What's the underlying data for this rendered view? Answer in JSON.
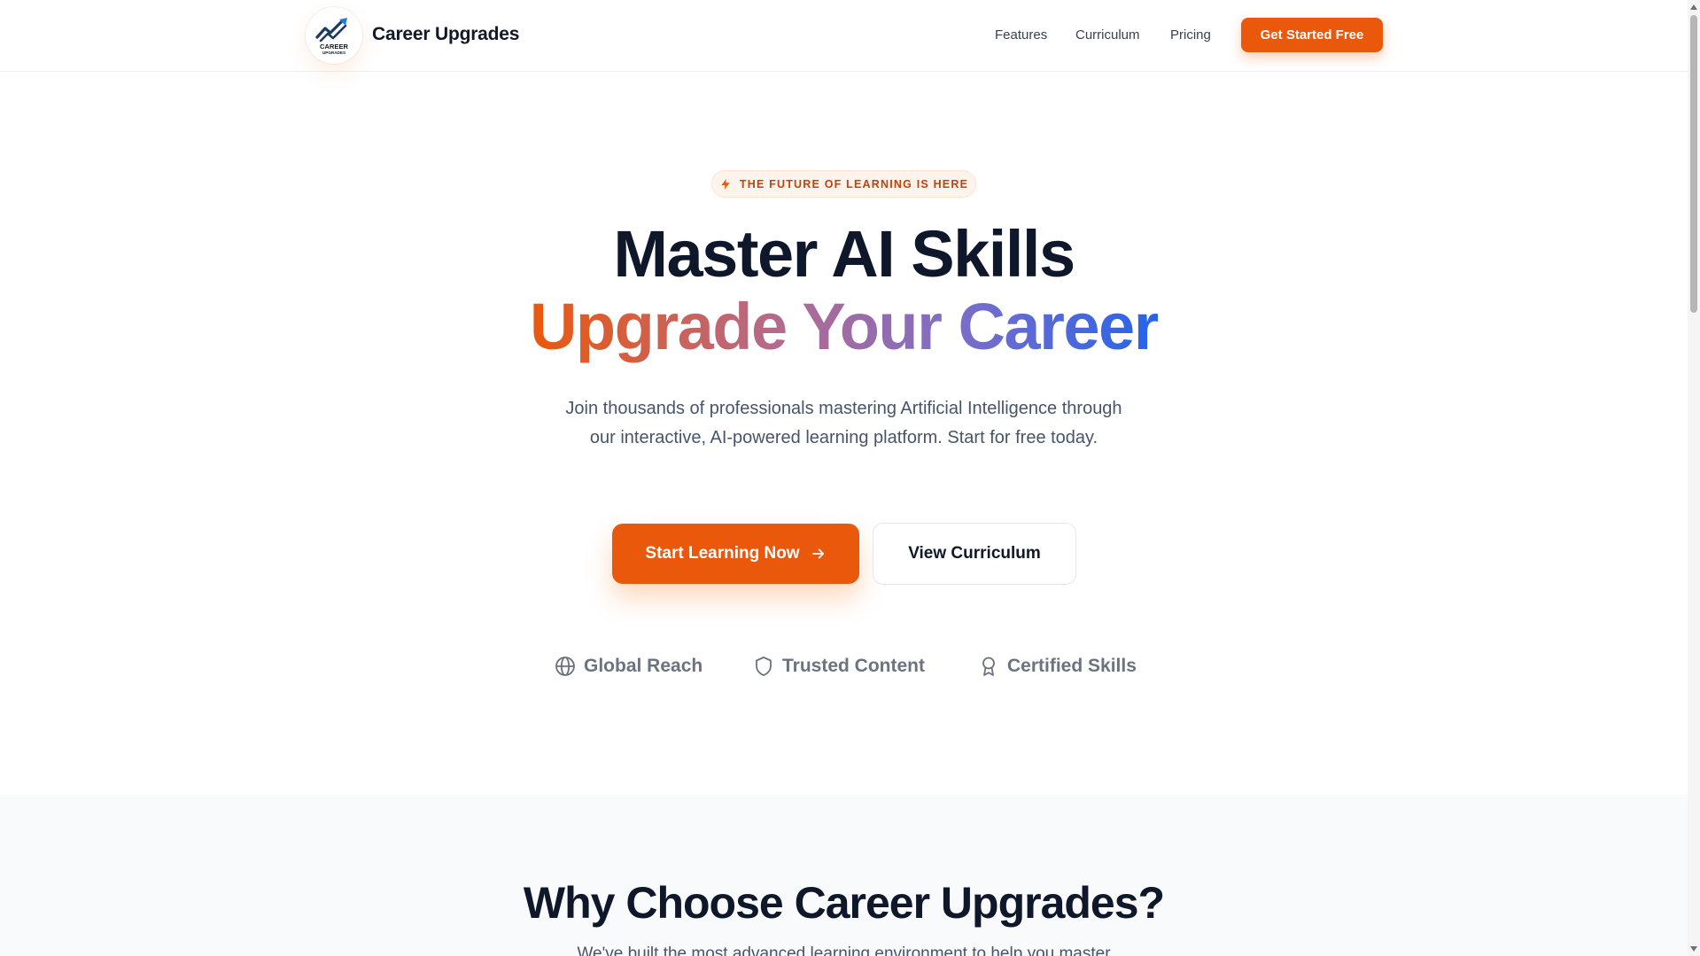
{
  "header": {
    "logo_icon": "career-upgrades-logo",
    "logo_text_top": "CAREER",
    "logo_text_bottom": "UPGRADES",
    "brand": "Career Upgrades",
    "nav": [
      "Features",
      "Curriculum",
      "Pricing"
    ],
    "cta": "Get Started Free"
  },
  "hero": {
    "badge_icon": "lightning-icon",
    "badge": "THE FUTURE OF LEARNING IS HERE",
    "title": "Master AI Skills",
    "subtitle": "Upgrade Your Career",
    "description": "Join thousands of professionals mastering Artificial Intelligence through our interactive, AI-powered learning platform. Start for free today.",
    "primary_button": "Start Learning Now",
    "primary_button_icon": "arrow-right-icon",
    "secondary_button": "View Curriculum"
  },
  "trust": [
    {
      "icon": "globe-icon",
      "label": "Global Reach"
    },
    {
      "icon": "shield-icon",
      "label": "Trusted Content"
    },
    {
      "icon": "award-icon",
      "label": "Certified Skills"
    }
  ],
  "why": {
    "title": "Why Choose Career Upgrades?",
    "description": "We've built the most advanced learning environment to help you master"
  },
  "colors": {
    "accent": "#ea580c",
    "gradient_start": "#ea580c",
    "gradient_end": "#2563eb",
    "heading": "#0f172a",
    "muted": "#6b7280"
  }
}
